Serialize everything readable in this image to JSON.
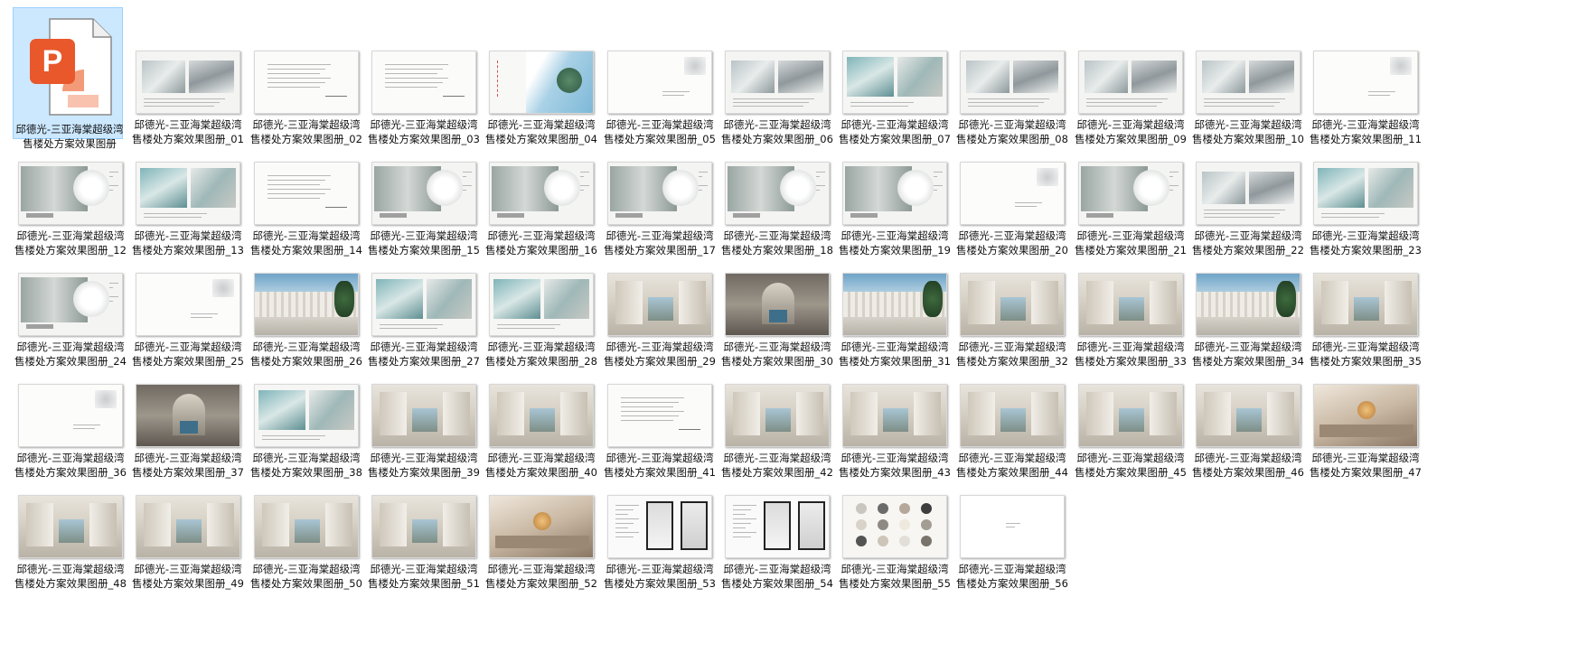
{
  "window": {
    "view": "large-icons"
  },
  "files": [
    {
      "name": "邱德光-三亚海棠超级湾售楼处方案效果图册",
      "type": "pptx",
      "selected": true,
      "icon": "powerpoint-icon"
    },
    {
      "name": "邱德光-三亚海棠超级湾售楼处方案效果图册_01",
      "type": "image",
      "thumb": "gray-images"
    },
    {
      "name": "邱德光-三亚海棠超级湾售楼处方案效果图册_02",
      "type": "image",
      "thumb": "text-doc"
    },
    {
      "name": "邱德光-三亚海棠超级湾售楼处方案效果图册_03",
      "type": "image",
      "thumb": "text-doc"
    },
    {
      "name": "邱德光-三亚海棠超级湾售楼处方案效果图册_04",
      "type": "image",
      "thumb": "map"
    },
    {
      "name": "邱德光-三亚海棠超级湾售楼处方案效果图册_05",
      "type": "image",
      "thumb": "blank-sketch"
    },
    {
      "name": "邱德光-三亚海棠超级湾售楼处方案效果图册_06",
      "type": "image",
      "thumb": "gray-images"
    },
    {
      "name": "邱德光-三亚海棠超级湾售楼处方案效果图册_07",
      "type": "image",
      "thumb": "teal-images"
    },
    {
      "name": "邱德光-三亚海棠超级湾售楼处方案效果图册_08",
      "type": "image",
      "thumb": "gray-images"
    },
    {
      "name": "邱德光-三亚海棠超级湾售楼处方案效果图册_09",
      "type": "image",
      "thumb": "gray-images"
    },
    {
      "name": "邱德光-三亚海棠超级湾售楼处方案效果图册_10",
      "type": "image",
      "thumb": "gray-images"
    },
    {
      "name": "邱德光-三亚海棠超级湾售楼处方案效果图册_11",
      "type": "image",
      "thumb": "blank-sketch"
    },
    {
      "name": "邱德光-三亚海棠超级湾售楼处方案效果图册_12",
      "type": "image",
      "thumb": "plan"
    },
    {
      "name": "邱德光-三亚海棠超级湾售楼处方案效果图册_13",
      "type": "image",
      "thumb": "teal-images"
    },
    {
      "name": "邱德光-三亚海棠超级湾售楼处方案效果图册_14",
      "type": "image",
      "thumb": "text-doc"
    },
    {
      "name": "邱德光-三亚海棠超级湾售楼处方案效果图册_15",
      "type": "image",
      "thumb": "plan"
    },
    {
      "name": "邱德光-三亚海棠超级湾售楼处方案效果图册_16",
      "type": "image",
      "thumb": "plan"
    },
    {
      "name": "邱德光-三亚海棠超级湾售楼处方案效果图册_17",
      "type": "image",
      "thumb": "plan"
    },
    {
      "name": "邱德光-三亚海棠超级湾售楼处方案效果图册_18",
      "type": "image",
      "thumb": "plan"
    },
    {
      "name": "邱德光-三亚海棠超级湾售楼处方案效果图册_19",
      "type": "image",
      "thumb": "plan"
    },
    {
      "name": "邱德光-三亚海棠超级湾售楼处方案效果图册_20",
      "type": "image",
      "thumb": "blank-sketch"
    },
    {
      "name": "邱德光-三亚海棠超级湾售楼处方案效果图册_21",
      "type": "image",
      "thumb": "plan"
    },
    {
      "name": "邱德光-三亚海棠超级湾售楼处方案效果图册_22",
      "type": "image",
      "thumb": "gray-images"
    },
    {
      "name": "邱德光-三亚海棠超级湾售楼处方案效果图册_23",
      "type": "image",
      "thumb": "teal-images"
    },
    {
      "name": "邱德光-三亚海棠超级湾售楼处方案效果图册_24",
      "type": "image",
      "thumb": "plan"
    },
    {
      "name": "邱德光-三亚海棠超级湾售楼处方案效果图册_25",
      "type": "image",
      "thumb": "blank-sketch"
    },
    {
      "name": "邱德光-三亚海棠超级湾售楼处方案效果图册_26",
      "type": "image",
      "thumb": "exterior"
    },
    {
      "name": "邱德光-三亚海棠超级湾售楼处方案效果图册_27",
      "type": "image",
      "thumb": "teal-images"
    },
    {
      "name": "邱德光-三亚海棠超级湾售楼处方案效果图册_28",
      "type": "image",
      "thumb": "teal-images"
    },
    {
      "name": "邱德光-三亚海棠超级湾售楼处方案效果图册_29",
      "type": "image",
      "thumb": "interior"
    },
    {
      "name": "邱德光-三亚海棠超级湾售楼处方案效果图册_30",
      "type": "image",
      "thumb": "interior-dark"
    },
    {
      "name": "邱德光-三亚海棠超级湾售楼处方案效果图册_31",
      "type": "image",
      "thumb": "exterior"
    },
    {
      "name": "邱德光-三亚海棠超级湾售楼处方案效果图册_32",
      "type": "image",
      "thumb": "interior"
    },
    {
      "name": "邱德光-三亚海棠超级湾售楼处方案效果图册_33",
      "type": "image",
      "thumb": "interior"
    },
    {
      "name": "邱德光-三亚海棠超级湾售楼处方案效果图册_34",
      "type": "image",
      "thumb": "exterior"
    },
    {
      "name": "邱德光-三亚海棠超级湾售楼处方案效果图册_35",
      "type": "image",
      "thumb": "interior"
    },
    {
      "name": "邱德光-三亚海棠超级湾售楼处方案效果图册_36",
      "type": "image",
      "thumb": "blank-sketch"
    },
    {
      "name": "邱德光-三亚海棠超级湾售楼处方案效果图册_37",
      "type": "image",
      "thumb": "interior-dark"
    },
    {
      "name": "邱德光-三亚海棠超级湾售楼处方案效果图册_38",
      "type": "image",
      "thumb": "teal-images"
    },
    {
      "name": "邱德光-三亚海棠超级湾售楼处方案效果图册_39",
      "type": "image",
      "thumb": "interior"
    },
    {
      "name": "邱德光-三亚海棠超级湾售楼处方案效果图册_40",
      "type": "image",
      "thumb": "interior"
    },
    {
      "name": "邱德光-三亚海棠超级湾售楼处方案效果图册_41",
      "type": "image",
      "thumb": "text-doc"
    },
    {
      "name": "邱德光-三亚海棠超级湾售楼处方案效果图册_42",
      "type": "image",
      "thumb": "interior"
    },
    {
      "name": "邱德光-三亚海棠超级湾售楼处方案效果图册_43",
      "type": "image",
      "thumb": "interior"
    },
    {
      "name": "邱德光-三亚海棠超级湾售楼处方案效果图册_44",
      "type": "image",
      "thumb": "interior"
    },
    {
      "name": "邱德光-三亚海棠超级湾售楼处方案效果图册_45",
      "type": "image",
      "thumb": "interior"
    },
    {
      "name": "邱德光-三亚海棠超级湾售楼处方案效果图册_46",
      "type": "image",
      "thumb": "interior"
    },
    {
      "name": "邱德光-三亚海棠超级湾售楼处方案效果图册_47",
      "type": "image",
      "thumb": "warm"
    },
    {
      "name": "邱德光-三亚海棠超级湾售楼处方案效果图册_48",
      "type": "image",
      "thumb": "interior"
    },
    {
      "name": "邱德光-三亚海棠超级湾售楼处方案效果图册_49",
      "type": "image",
      "thumb": "interior"
    },
    {
      "name": "邱德光-三亚海棠超级湾售楼处方案效果图册_50",
      "type": "image",
      "thumb": "interior"
    },
    {
      "name": "邱德光-三亚海棠超级湾售楼处方案效果图册_51",
      "type": "image",
      "thumb": "interior"
    },
    {
      "name": "邱德光-三亚海棠超级湾售楼处方案效果图册_52",
      "type": "image",
      "thumb": "warm"
    },
    {
      "name": "邱德光-三亚海棠超级湾售楼处方案效果图册_53",
      "type": "image",
      "thumb": "frames"
    },
    {
      "name": "邱德光-三亚海棠超级湾售楼处方案效果图册_54",
      "type": "image",
      "thumb": "frames"
    },
    {
      "name": "邱德光-三亚海棠超级湾售楼处方案效果图册_55",
      "type": "image",
      "thumb": "swatches"
    },
    {
      "name": "邱德光-三亚海棠超级湾售楼处方案效果图册_56",
      "type": "image",
      "thumb": "blank"
    }
  ],
  "colors": {
    "selection_bg": "#cce8ff",
    "selection_border": "#99d1ff",
    "powerpoint_orange": "#e8582b",
    "powerpoint_light": "#f39a78"
  }
}
